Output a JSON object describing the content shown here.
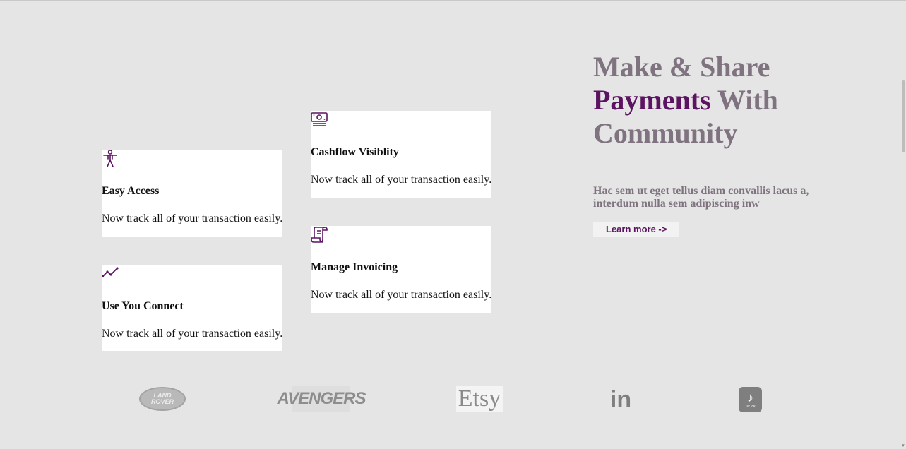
{
  "features": [
    {
      "icon": "accessibility-icon",
      "title": "Easy Access",
      "text": "Now track all of your transaction easily."
    },
    {
      "icon": "chart-line-icon",
      "title": "Use You Connect",
      "text": "Now track all of your transaction easily."
    },
    {
      "icon": "cash-icon",
      "title": "Cashflow Visiblity",
      "text": "Now track all of your transaction easily."
    },
    {
      "icon": "invoice-icon",
      "title": "Manage Invoicing",
      "text": "Now track all of your transaction easily."
    }
  ],
  "hero": {
    "line1": "Make & Share",
    "line2_accent": "Payments",
    "line2_rest": " With",
    "line3": "Community",
    "description": "Hac sem ut eget tellus diam convallis lacus a, interdum nulla sem adipiscing inw",
    "button_label": "Learn more ->"
  },
  "logos": {
    "landrover_line1": "LAND",
    "landrover_line2": "ROVER",
    "avengers": "AVENGERS",
    "etsy": "Etsy",
    "linkedin": "in",
    "tiktok_glyph": "♪",
    "tiktok_name": "TikTok"
  },
  "colors": {
    "accent": "#5c1361",
    "muted": "#7f7380",
    "background": "#e5e5e5"
  }
}
